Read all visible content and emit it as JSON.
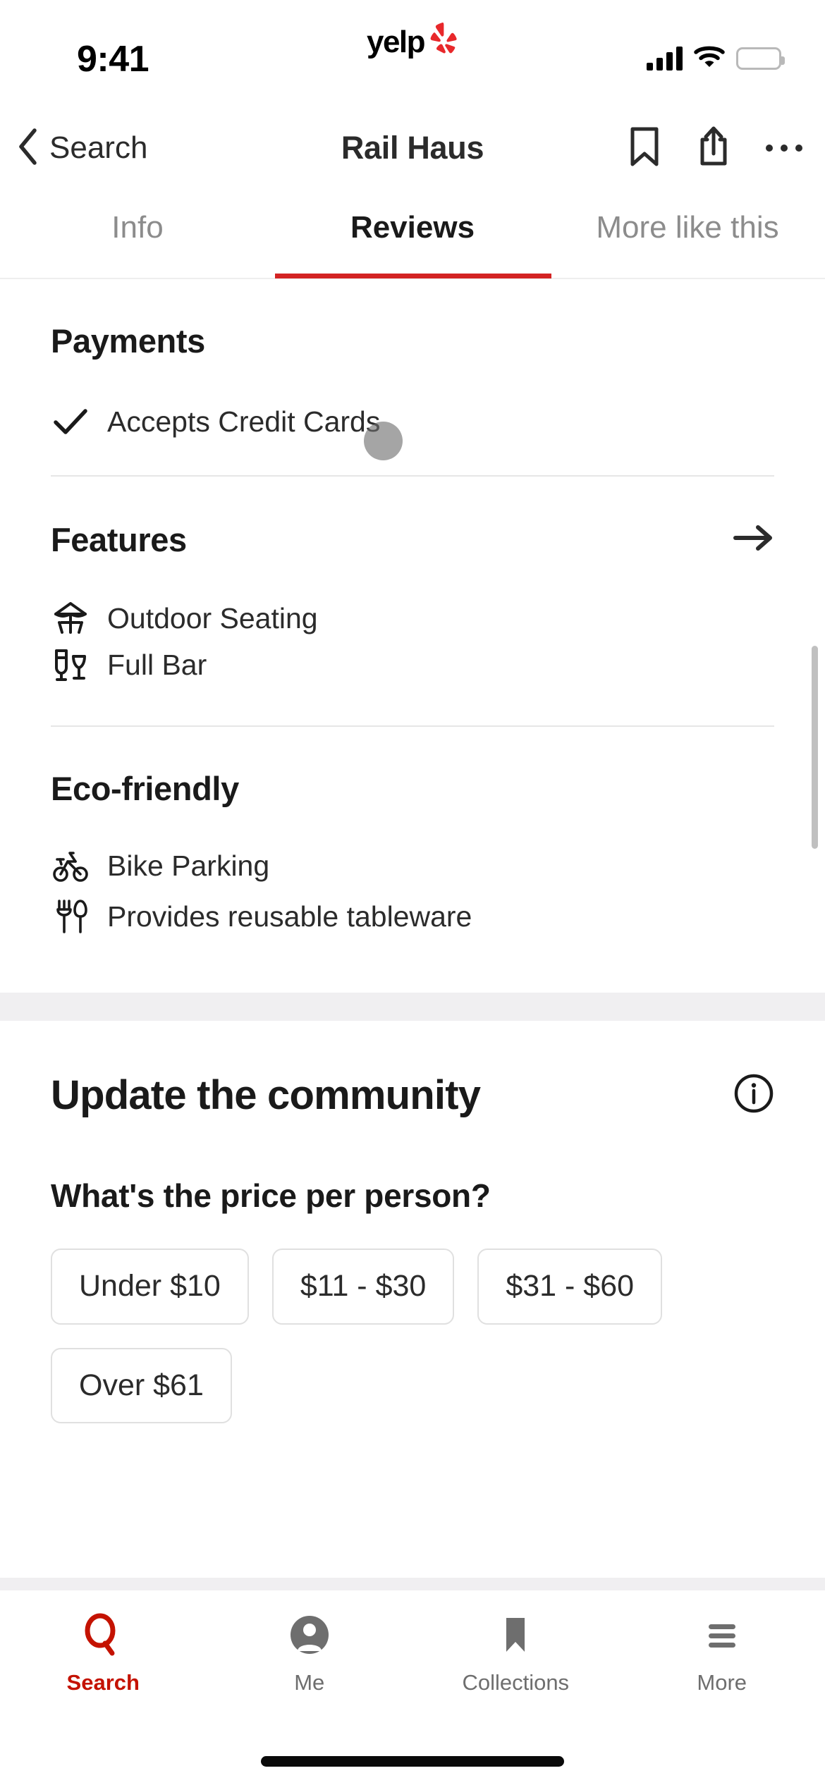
{
  "status_bar": {
    "time": "9:41",
    "brand": "yelp",
    "icons": [
      "cellular-signal-icon",
      "wifi-icon",
      "battery-icon"
    ]
  },
  "nav": {
    "back_label": "Search",
    "title": "Rail Haus",
    "actions": [
      {
        "name": "bookmark-icon"
      },
      {
        "name": "share-icon"
      },
      {
        "name": "more-options-icon"
      }
    ]
  },
  "tabs": {
    "items": [
      {
        "label": "Info",
        "active": false
      },
      {
        "label": "Reviews",
        "active": true
      },
      {
        "label": "More like this",
        "active": false
      }
    ],
    "active_color": "#d32323"
  },
  "sections": {
    "payments": {
      "title": "Payments",
      "items": [
        {
          "label": "Accepts Credit Cards",
          "icon": "check-icon"
        }
      ]
    },
    "features": {
      "title": "Features",
      "chevron": "arrow-right-icon",
      "items": [
        {
          "label": "Outdoor Seating",
          "icon": "outdoor-seating-icon"
        },
        {
          "label": "Full Bar",
          "icon": "full-bar-icon"
        }
      ]
    },
    "eco_friendly": {
      "title": "Eco-friendly",
      "items": [
        {
          "label": "Bike Parking",
          "icon": "bike-icon"
        },
        {
          "label": "Provides reusable tableware",
          "icon": "utensils-icon"
        }
      ]
    },
    "update_community": {
      "title": "Update the community",
      "info_icon": "info-circle-icon",
      "question": "What's the price per person?",
      "price_options": [
        "Under $10",
        "$11 - $30",
        "$31 - $60",
        "Over $61"
      ]
    }
  },
  "tabbar": {
    "items": [
      {
        "label": "Search",
        "icon": "search-icon",
        "active": true
      },
      {
        "label": "Me",
        "icon": "profile-icon",
        "active": false
      },
      {
        "label": "Collections",
        "icon": "bookmark-filled-icon",
        "active": false
      },
      {
        "label": "More",
        "icon": "hamburger-menu-icon",
        "active": false
      }
    ],
    "active_color": "#c41200",
    "inactive_color": "#6e6e6e"
  }
}
